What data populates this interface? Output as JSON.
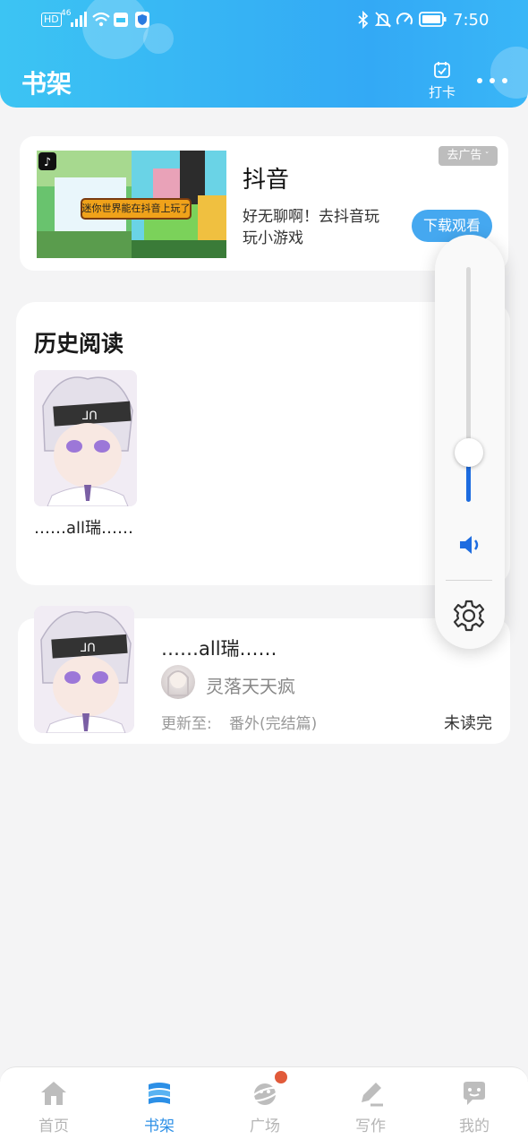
{
  "status_bar": {
    "hd": "HD",
    "network": "46",
    "time": "7:50"
  },
  "header": {
    "title": "书架",
    "checkin_label": "打卡"
  },
  "ad": {
    "app_name": "抖音",
    "description": "好无聊啊！去抖音玩玩小游戏",
    "badge": "去广告",
    "download_label": "下载观看",
    "banner_text": "迷你世界能在抖音上玩了"
  },
  "history": {
    "title": "历史阅读",
    "book_name": "……all瑞……"
  },
  "book": {
    "title": "……all瑞……",
    "author": "灵落天天疯",
    "update_label": "更新至:",
    "update_chapter": "番外(完结篇)",
    "status": "未读完"
  },
  "volume": {
    "level": 0.21
  },
  "nav": {
    "items": [
      {
        "label": "首页",
        "icon": "home-icon"
      },
      {
        "label": "书架",
        "icon": "bookshelf-icon",
        "active": true
      },
      {
        "label": "广场",
        "icon": "plaza-icon",
        "badge_dot": true
      },
      {
        "label": "写作",
        "icon": "write-icon"
      },
      {
        "label": "我的",
        "icon": "profile-icon"
      }
    ]
  },
  "colors": {
    "header": "#33a9f5",
    "accent": "#2c8fe6",
    "volume": "#1d6ce0",
    "badge_dot": "#e15a3a"
  }
}
